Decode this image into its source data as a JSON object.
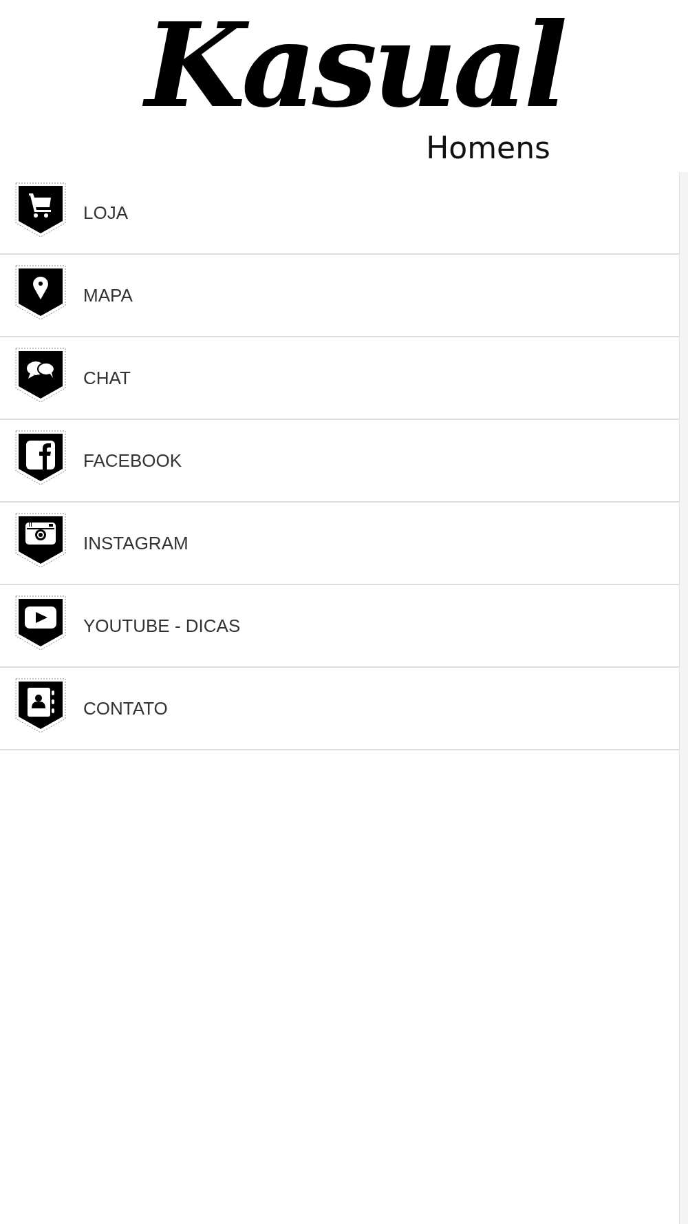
{
  "logo": {
    "name": "Kasual",
    "tagline": "Homens"
  },
  "menu": [
    {
      "kind": "cart",
      "label": "LOJA"
    },
    {
      "kind": "pin",
      "label": "MAPA"
    },
    {
      "kind": "chat",
      "label": "CHAT"
    },
    {
      "kind": "facebook",
      "label": "FACEBOOK"
    },
    {
      "kind": "camera",
      "label": "INSTAGRAM"
    },
    {
      "kind": "play",
      "label": "YOUTUBE - DICAS"
    },
    {
      "kind": "contact",
      "label": "CONTATO"
    }
  ]
}
